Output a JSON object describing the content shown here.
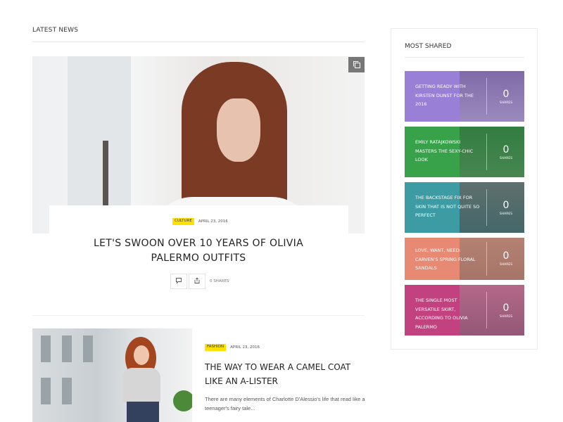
{
  "latest_news": {
    "heading": "LATEST NEWS",
    "featured": {
      "category": "CULTURE",
      "date": "APRIL 23, 2016",
      "title": "LET'S SWOON OVER 10 YEARS OF OLIVIA PALERMO OUTFITS",
      "shares": "0 SHARES",
      "icons": [
        "gallery-icon",
        "comment-icon",
        "share-icon"
      ]
    },
    "second": {
      "category": "FASHION",
      "date": "APRIL 23, 2016",
      "title": "THE WAY TO WEAR A CAMEL COAT LIKE AN A-LISTER",
      "excerpt": "There are many elements of Charlotte D'Alessio's life that read like a teenager's fairy tale..."
    }
  },
  "most_shared": {
    "heading": "MOST SHARED",
    "items": [
      {
        "title": "GETTING READY WITH KIRSTEN DUNST FOR THE 2016",
        "count": "0",
        "count_label": "SHARES",
        "color": "#9a7fd6"
      },
      {
        "title": "EMILY RATAJKOWSKI MASTERS THE SEXY-CHIC LOOK",
        "count": "0",
        "count_label": "SHARES",
        "color": "#37a24a"
      },
      {
        "title": "THE BACKSTAGE FIX FOR SKIN THAT IS NOT QUITE SO PERFECT",
        "count": "0",
        "count_label": "SHARES",
        "color": "#3d9ba3"
      },
      {
        "title": "LOVE, WANT, NEED: CARVEN'S SPRING FLORAL SANDALS",
        "count": "0",
        "count_label": "SHARES",
        "color": "#e88a73"
      },
      {
        "title": "THE SINGLE MOST VERSATILE SKIRT, ACCORDING TO OLIVIA PALERMO",
        "count": "0",
        "count_label": "SHARES",
        "color": "#c2417f"
      }
    ]
  },
  "colors": {
    "tag_yellow": "#ffe100",
    "border": "#eaeaea"
  }
}
